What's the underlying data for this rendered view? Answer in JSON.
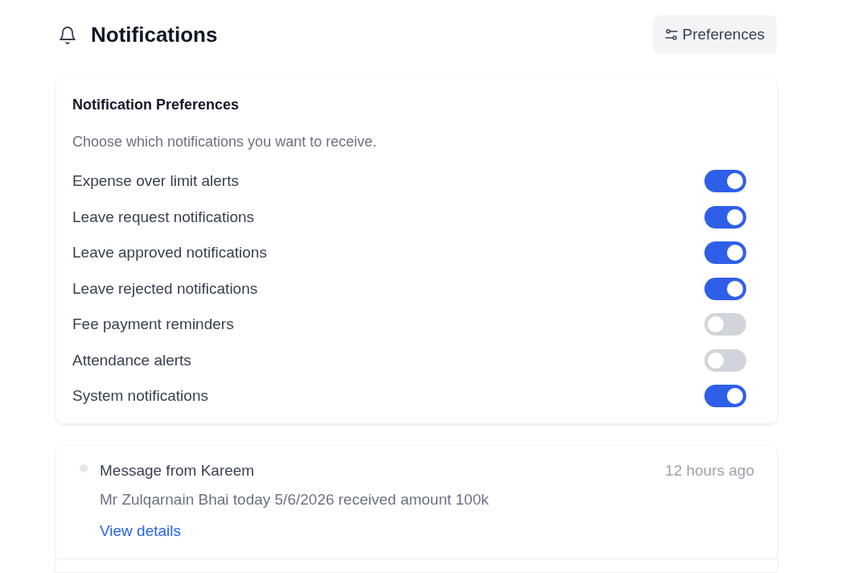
{
  "header": {
    "title": "Notifications",
    "preferences_button": "Preferences"
  },
  "preferences": {
    "title": "Notification Preferences",
    "description": "Choose which notifications you want to receive.",
    "items": [
      {
        "label": "Expense over limit alerts",
        "on": true
      },
      {
        "label": "Leave request notifications",
        "on": true
      },
      {
        "label": "Leave approved notifications",
        "on": true
      },
      {
        "label": "Leave rejected notifications",
        "on": true
      },
      {
        "label": "Fee payment reminders",
        "on": false
      },
      {
        "label": "Attendance alerts",
        "on": false
      },
      {
        "label": "System notifications",
        "on": true
      }
    ]
  },
  "notifications": [
    {
      "title": "Message from Kareem",
      "time": "12 hours ago",
      "body": "Mr Zulqarnain Bhai today 5/6/2026 received amount 100k",
      "link": "View details",
      "unread": false
    }
  ]
}
